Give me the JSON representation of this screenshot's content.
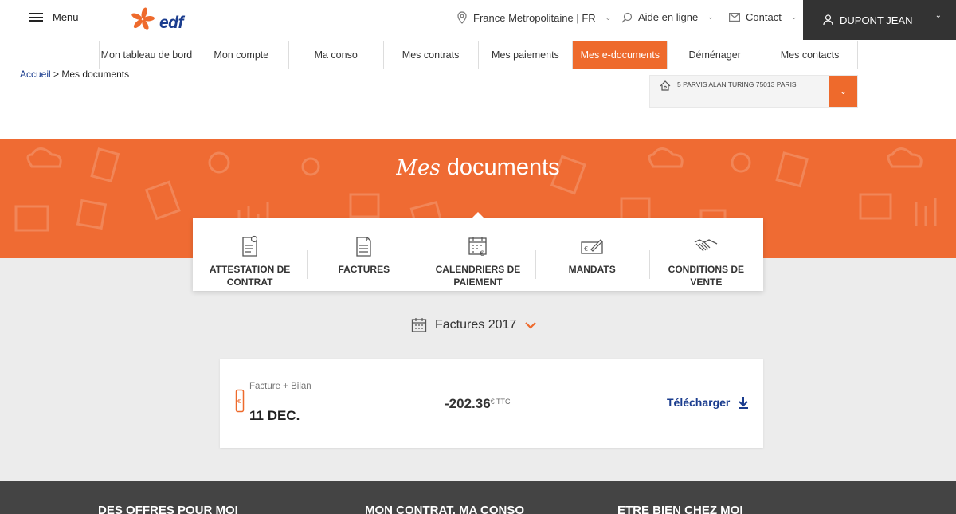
{
  "header": {
    "menu_label": "Menu",
    "logo_text": "edf",
    "region": "France Metropolitaine | FR",
    "help": "Aide en ligne",
    "contact": "Contact",
    "user_name": "DUPONT JEAN"
  },
  "nav": {
    "tabs": [
      {
        "label": "Mon tableau de bord"
      },
      {
        "label": "Mon compte"
      },
      {
        "label": "Ma conso"
      },
      {
        "label": "Mes contrats"
      },
      {
        "label": "Mes paiements"
      },
      {
        "label": "Mes e-documents",
        "active": true
      },
      {
        "label": "Déménager"
      },
      {
        "label": "Mes contacts"
      }
    ]
  },
  "breadcrumb": {
    "home": "Accueil",
    "separator": ">",
    "current": "Mes documents"
  },
  "address": {
    "text": "5 PARVIS ALAN TURING 75013 PARIS"
  },
  "hero": {
    "title_script": "Mes",
    "title_rest": "documents"
  },
  "categories": [
    {
      "line1": "ATTESTATION DE",
      "line2": "CONTRAT",
      "icon": "certificate-icon"
    },
    {
      "line1": "FACTURES",
      "line2": "",
      "icon": "invoice-euro-icon"
    },
    {
      "line1": "CALENDRIERS DE",
      "line2": "PAIEMENT",
      "icon": "calendar-euro-icon"
    },
    {
      "line1": "MANDATS",
      "line2": "",
      "icon": "cheque-icon"
    },
    {
      "line1": "CONDITIONS DE",
      "line2": "VENTE",
      "icon": "handshake-icon"
    }
  ],
  "year_selector": {
    "label": "Factures 2017"
  },
  "invoice": {
    "type": "Facture + Bilan",
    "date": "11 DEC.",
    "amount": "-202.36",
    "amount_suffix": "€ TTC",
    "download": "Télécharger"
  },
  "footer": {
    "col1": "DES OFFRES POUR MOI",
    "col2": "MON CONTRAT, MA CONSO",
    "col3": "ETRE BIEN CHEZ MOI"
  },
  "colors": {
    "accent": "#ee6a2c",
    "brand_blue": "#1a3c8e",
    "dark": "#333333"
  }
}
